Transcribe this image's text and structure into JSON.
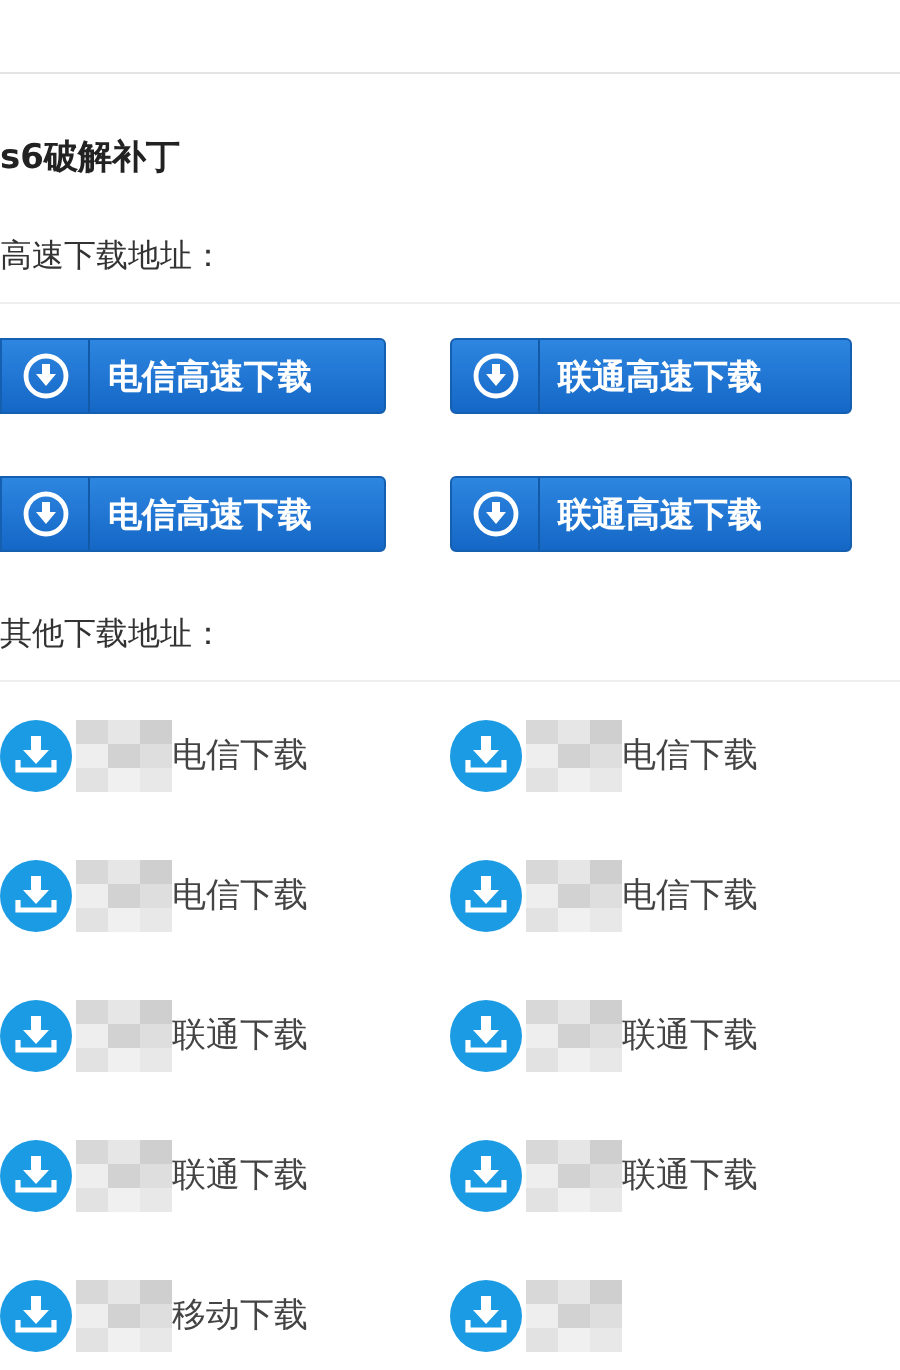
{
  "title": "s6破解补丁",
  "high_speed": {
    "heading": "高速下载地址：",
    "buttons": [
      {
        "label": "电信高速下载"
      },
      {
        "label": "联通高速下载"
      },
      {
        "label": "电信高速下载"
      },
      {
        "label": "联通高速下载"
      }
    ]
  },
  "other": {
    "heading": "其他下载地址：",
    "links": [
      {
        "label": "电信下载",
        "blurred": true
      },
      {
        "label": "电信下载",
        "blurred": true
      },
      {
        "label": "电信下载",
        "blurred": true
      },
      {
        "label": "电信下载",
        "blurred": true
      },
      {
        "label": "联通下载",
        "blurred": true
      },
      {
        "label": "联通下载",
        "blurred": true
      },
      {
        "label": "联通下载",
        "blurred": true
      },
      {
        "label": "联通下载",
        "blurred": true
      },
      {
        "label": "移动下载",
        "blurred": true
      },
      {
        "blurred": true
      }
    ]
  }
}
